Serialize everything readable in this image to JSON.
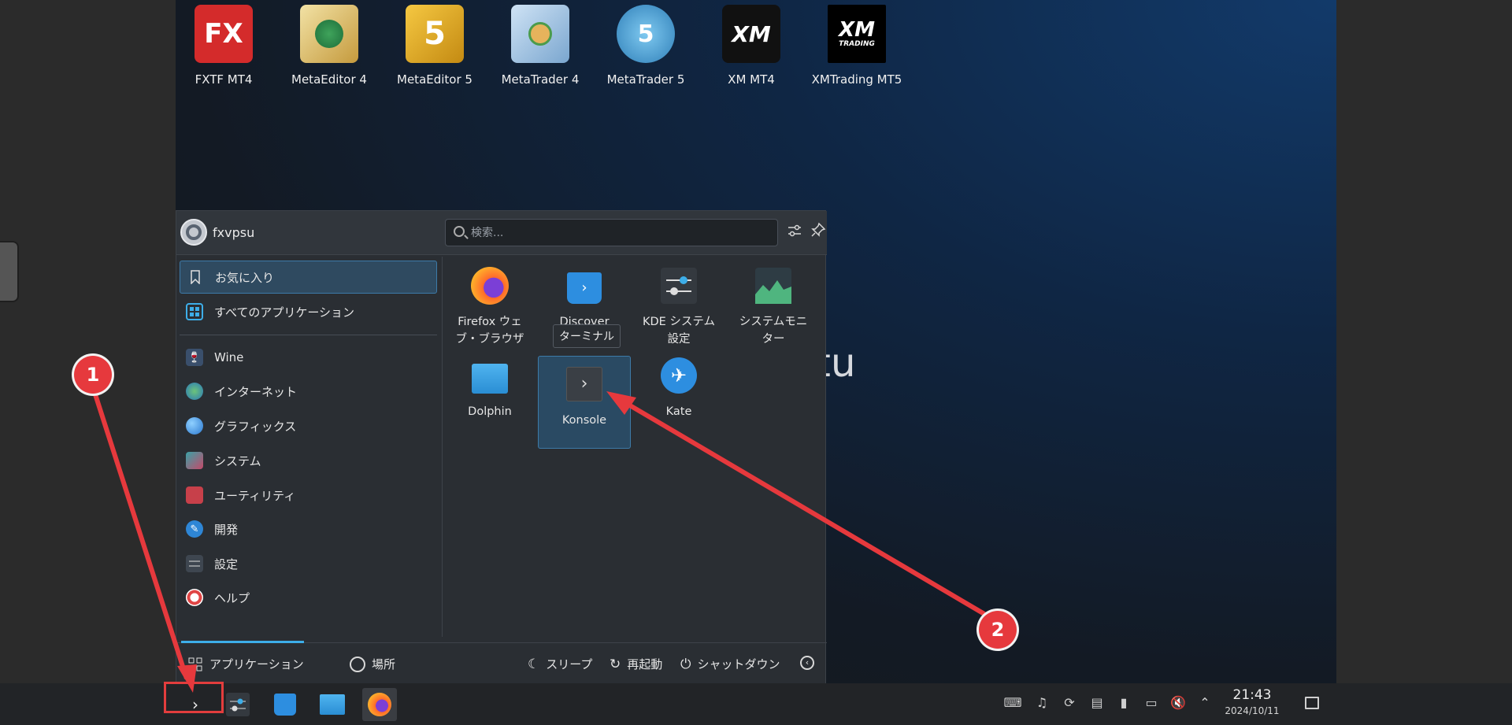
{
  "desktop_icons": [
    {
      "label": "FXTF MT4",
      "icon": "fxtf-mt4-icon"
    },
    {
      "label": "MetaEditor 4",
      "icon": "metaeditor4-icon"
    },
    {
      "label": "MetaEditor 5",
      "icon": "metaeditor5-icon"
    },
    {
      "label": "MetaTrader 4",
      "icon": "metatrader4-icon"
    },
    {
      "label": "MetaTrader 5",
      "icon": "metatrader5-icon"
    },
    {
      "label": "XM MT4",
      "icon": "xm-mt4-icon"
    },
    {
      "label": "XMTrading MT5",
      "icon": "xmtrading-mt5-icon"
    }
  ],
  "icon_text": {
    "fx": "FX",
    "five": "5",
    "five_b": "5",
    "xm": "XM",
    "xm2": "XM",
    "trading": "TRADING"
  },
  "wallpaper_logo": "kubuntu",
  "launcher": {
    "username": "fxvpsu",
    "search_placeholder": "検索...",
    "categories": [
      {
        "label": "お気に入り",
        "icon": "bookmark-icon",
        "selected": true
      },
      {
        "label": "すべてのアプリケーション",
        "icon": "grid-icon"
      },
      {
        "label": "Wine",
        "icon": "wine-icon"
      },
      {
        "label": "インターネット",
        "icon": "globe-icon"
      },
      {
        "label": "グラフィックス",
        "icon": "graphics-icon"
      },
      {
        "label": "システム",
        "icon": "system-icon"
      },
      {
        "label": "ユーティリティ",
        "icon": "toolbox-icon"
      },
      {
        "label": "開発",
        "icon": "development-icon"
      },
      {
        "label": "設定",
        "icon": "settings-icon"
      },
      {
        "label": "ヘルプ",
        "icon": "help-icon"
      }
    ],
    "apps": [
      {
        "label": "Firefox ウェ\nブ・ブラウザ",
        "icon": "firefox-icon"
      },
      {
        "label": "Discover",
        "icon": "discover-icon"
      },
      {
        "label": "KDE システム\n設定",
        "icon": "kde-settings-icon"
      },
      {
        "label": "システムモニ\nター",
        "icon": "system-monitor-icon"
      },
      {
        "label": "Dolphin",
        "icon": "dolphin-folder-icon"
      },
      {
        "label": "Konsole",
        "icon": "konsole-icon",
        "selected": true
      },
      {
        "label": "Kate",
        "icon": "kate-icon"
      }
    ],
    "tooltip": "ターミナル",
    "footer": {
      "tab_apps": "アプリケーション",
      "tab_places": "場所",
      "sleep": "スリープ",
      "restart": "再起動",
      "shutdown": "シャットダウン"
    }
  },
  "taskbar": {
    "apps": [
      "konsole-icon",
      "kde-settings-icon",
      "discover-icon",
      "dolphin-folder-icon",
      "firefox-icon"
    ],
    "tray": [
      "keyboard-icon",
      "notifications-icon",
      "update-icon",
      "clipboard-icon",
      "usb-icon",
      "network-icon",
      "volume-muted-icon",
      "chevron-up-icon"
    ],
    "time": "21:43",
    "date": "2024/10/11"
  },
  "annotations": [
    {
      "label": "1"
    },
    {
      "label": "2"
    }
  ],
  "colors": {
    "accent": "#3daee9",
    "annotation": "#e6393d",
    "selection": "#2f4a60"
  }
}
